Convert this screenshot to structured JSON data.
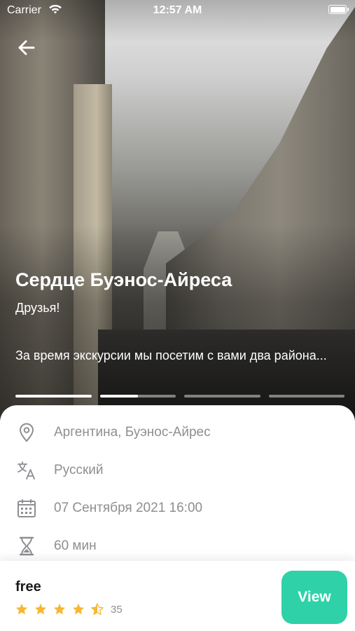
{
  "status_bar": {
    "carrier": "Carrier",
    "time": "12:57 AM"
  },
  "tour": {
    "title": "Сердце Буэнос-Айреса",
    "subtitle": "Друзья!",
    "description": "За время экскурсии мы посетим с вами два района...",
    "slides_progress": [
      1.0,
      0.5,
      0.0,
      0.0
    ]
  },
  "details": {
    "location": "Аргентина, Буэнос-Айрес",
    "language": "Русский",
    "datetime": "07 Сентября 2021 16:00",
    "duration": "60 мин"
  },
  "booking": {
    "price": "free",
    "rating": 4.5,
    "rating_max": 5,
    "reviews_count": "35",
    "view_label": "View"
  },
  "colors": {
    "accent": "#2ed1a8",
    "star": "#f7b733",
    "muted_text": "#8e8e93"
  },
  "icons": [
    "wifi-icon",
    "battery-icon",
    "back-arrow-icon",
    "location-pin-icon",
    "translate-icon",
    "calendar-icon",
    "hourglass-icon",
    "star-icon",
    "half-star-icon"
  ]
}
